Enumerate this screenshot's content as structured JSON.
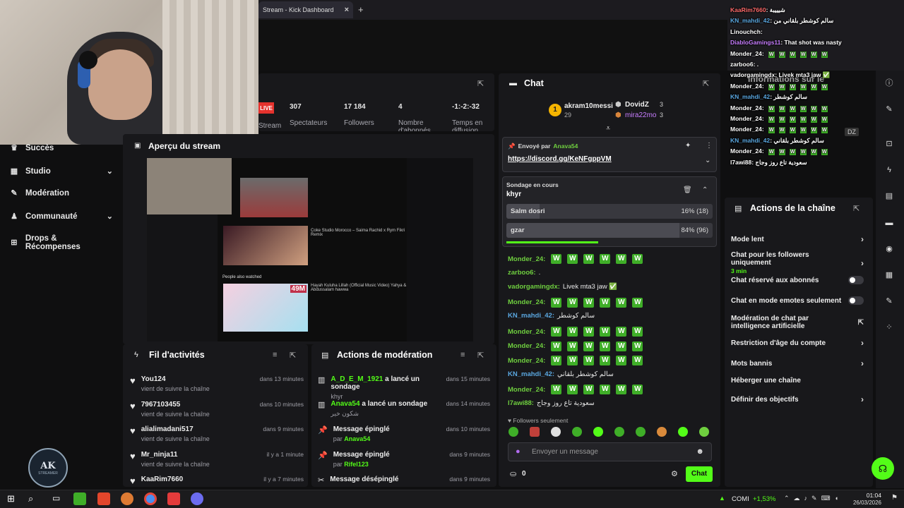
{
  "browser": {
    "tab_title": "Stream - Kick Dashboard",
    "close_glyph": "×",
    "newtab_glyph": "+"
  },
  "sidebar": {
    "items": [
      {
        "label": "Succès",
        "icon": "trophy-icon"
      },
      {
        "label": "Studio",
        "icon": "studio-icon",
        "chevron": "⌄"
      },
      {
        "label": "Modération",
        "icon": "wrench-icon"
      },
      {
        "label": "Communauté",
        "icon": "users-icon",
        "chevron": "⌄"
      },
      {
        "label": "Drops & Récompenses",
        "icon": "gift-icon"
      }
    ],
    "logo_text": "AK",
    "logo_sub": "STREAMER"
  },
  "stats": {
    "live_badge": "LIVE",
    "live_label": "Stream",
    "viewers_value": "307",
    "viewers_label": "Spectateurs",
    "followers_value": "17 184",
    "followers_label": "Followers",
    "subs_value": "4",
    "subs_label": "Nombre d'abonnés",
    "duration_value": "-1:-2:-32",
    "duration_label": "Temps en diffusion"
  },
  "preview": {
    "title": "Aperçu du stream",
    "video_badge": "49M",
    "people_also_watched": "People also watched",
    "video1": "Coke Studio Morocco – Saima Rachid x Rym Fikri Remix",
    "video2": "Hayah Kuluha Lillah (Official Music Video) Yahya & Abdussalam hawwa"
  },
  "activity": {
    "title": "Fil d'activités",
    "items": [
      {
        "name": "You124",
        "sub": "vient de suivre la chaîne",
        "time": "dans 13 minutes"
      },
      {
        "name": "7967103455",
        "sub": "vient de suivre la chaîne",
        "time": "dans 10 minutes"
      },
      {
        "name": "alialimadani517",
        "sub": "vient de suivre la chaîne",
        "time": "dans 9 minutes"
      },
      {
        "name": "Mr_ninja11",
        "sub": "vient de suivre la chaîne",
        "time": "il y a 1 minute"
      },
      {
        "name": "KaaRim7660",
        "sub": "",
        "time": "il y a 7 minutes"
      }
    ]
  },
  "moderation": {
    "title": "Actions de modération",
    "items": [
      {
        "user": "A_D_E_M_1921",
        "action": " a lancé un sondage",
        "sub": "khyr",
        "time": "dans 15 minutes"
      },
      {
        "user": "Anava54",
        "action": " a lancé un sondage",
        "sub": "شكون خير",
        "time": "dans 14 minutes"
      },
      {
        "user": "",
        "action": "Message épinglé",
        "sub_prefix": "par ",
        "sub": "Anava54",
        "time": "dans 10 minutes"
      },
      {
        "user": "",
        "action": "Message épinglé",
        "sub_prefix": "par ",
        "sub": "Rifel123",
        "time": "dans 9 minutes"
      },
      {
        "user": "",
        "action": "Message désépinglé",
        "sub": "",
        "time": "dans 9 minutes"
      }
    ]
  },
  "chat": {
    "title": "Chat",
    "top_gifters": [
      {
        "rank": "1",
        "name": "akram10messi",
        "count": "29"
      },
      {
        "name": "DovidZ",
        "count": "3"
      },
      {
        "name": "mira22mo",
        "count": "3"
      }
    ],
    "pinned_by_label": "Envoyé par",
    "pinned_by_user": "Anava54",
    "pinned_link": "https://discord.gg/KeNFgppVM",
    "poll_label": "Sondage en cours",
    "poll_question": "khyr",
    "poll_options": [
      {
        "label": "Salm dosri",
        "result": "16% (18)",
        "fill": 0.16
      },
      {
        "label": "gzar",
        "result": "84% (96)",
        "fill": 0.84
      }
    ],
    "messages": [
      {
        "user": "Monder_24:",
        "text": "",
        "w": 6
      },
      {
        "user": "zarboo6:",
        "text": ".",
        "w": 0
      },
      {
        "user": "vadorgamingdx:",
        "text": "Livek mta3 jaw ✅",
        "w": 0
      },
      {
        "user": "Monder_24:",
        "text": "",
        "w": 6
      },
      {
        "user": "KN_mahdi_42:",
        "text": "سالم كوشطر",
        "w": 0,
        "blue": true
      },
      {
        "user": "Monder_24:",
        "text": "",
        "w": 6
      },
      {
        "user": "Monder_24:",
        "text": "",
        "w": 6
      },
      {
        "user": "Monder_24:",
        "text": "",
        "w": 6
      },
      {
        "user": "KN_mahdi_42:",
        "text": "سالم كوشطر بلقاني",
        "w": 0,
        "blue": true
      },
      {
        "user": "Monder_24:",
        "text": "",
        "w": 6
      },
      {
        "user": "l7awi88:",
        "text": "سعودية تاع روز وجاج",
        "w": 0
      }
    ],
    "w_letter": "W",
    "followers_only": "Followers seulement",
    "input_placeholder": "Envoyer un message",
    "points": "0",
    "send_label": "Chat"
  },
  "channel_actions": {
    "title": "Actions de la chaîne",
    "items": [
      {
        "label": "Mode lent",
        "kind": "chevron"
      },
      {
        "label": "Chat pour les followers uniquement",
        "sub": "3 min",
        "kind": "chevron"
      },
      {
        "label": "Chat réservé aux abonnés",
        "kind": "toggle"
      },
      {
        "label": "Chat en mode emotes seulement",
        "kind": "toggle"
      },
      {
        "label": "Modération de chat par intelligence artificielle",
        "kind": "external"
      },
      {
        "label": "Restriction d'âge du compte",
        "kind": "chevron"
      },
      {
        "label": "Mots bannis",
        "kind": "chevron"
      },
      {
        "label": "Héberger une chaîne",
        "kind": "none"
      },
      {
        "label": "Définir des objectifs",
        "kind": "chevron"
      }
    ]
  },
  "overlay_chat": {
    "info_title": "Informations sur le",
    "country": "DZ",
    "lines": [
      {
        "user": "KaaRim7660",
        "text": ": شيييبة",
        "color": "#ff6b6b"
      },
      {
        "user": "KN_mahdi_42",
        "text": ": سالم كوشطر بلقاني من",
        "color": "#5aa7e0"
      },
      {
        "user": "Linouchch",
        "text": ":",
        "color": "#ffffff"
      },
      {
        "user": "DiabloGamings11",
        "text": ": That shot was nasty",
        "color": "#c77dff"
      },
      {
        "user": "Monder_24",
        "text": ":",
        "color": "#ffffff",
        "w": 6
      },
      {
        "user": "zarboo6",
        "text": ": .",
        "color": "#ffffff"
      },
      {
        "user": "vadorgamingdx",
        "text": ": Livek mta3 jaw ✅",
        "color": "#ffffff"
      },
      {
        "user": "Monder_24",
        "text": ":",
        "color": "#ffffff",
        "w": 6
      },
      {
        "user": "KN_mahdi_42",
        "text": ": سالم كوشطر",
        "color": "#5aa7e0"
      },
      {
        "user": "Monder_24",
        "text": ":",
        "color": "#ffffff",
        "w": 6
      },
      {
        "user": "Monder_24",
        "text": ":",
        "color": "#ffffff",
        "w": 6
      },
      {
        "user": "Monder_24",
        "text": ":",
        "color": "#ffffff",
        "w": 6
      },
      {
        "user": "KN_mahdi_42",
        "text": ": سالم كوشطر بلقاني",
        "color": "#5aa7e0"
      },
      {
        "user": "Monder_24",
        "text": ":",
        "color": "#ffffff",
        "w": 6
      },
      {
        "user": "l7awi88",
        "text": ": سعودية تاع روز وجاج",
        "color": "#ffffff"
      }
    ]
  },
  "taskbar": {
    "stock_label": "COMI",
    "stock_change": "+1,53%",
    "time": "01:04",
    "date": "26/03/2026"
  },
  "colors": {
    "accent": "#53fc18",
    "live": "#e5322d",
    "panel": "#18181b"
  }
}
